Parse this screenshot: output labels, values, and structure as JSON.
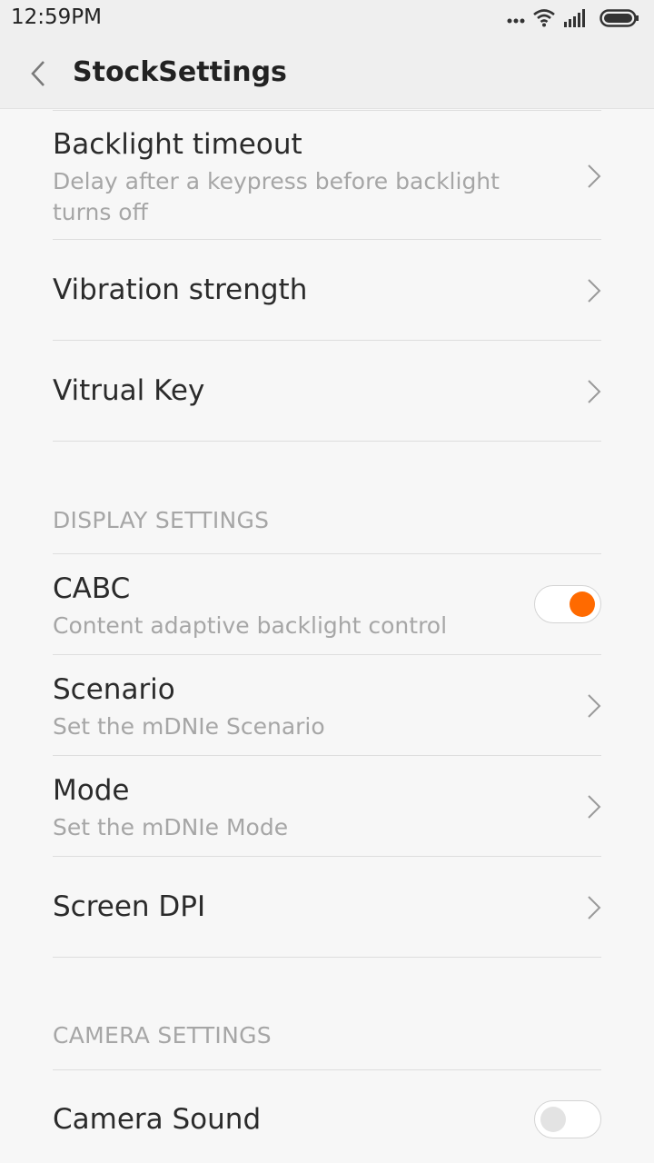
{
  "status": {
    "time": "12:59PM",
    "icons": [
      "more-dots-icon",
      "wifi-icon",
      "signal-icon",
      "battery-icon"
    ]
  },
  "appbar": {
    "title": "StockSettings"
  },
  "items": {
    "backlight": {
      "title": "Backlight timeout",
      "subtitle": "Delay after a keypress before backlight turns off"
    },
    "vibration": {
      "title": "Vibration strength"
    },
    "virtual_key": {
      "title": "Vitrual Key"
    },
    "cabc": {
      "title": "CABC",
      "subtitle": "Content adaptive backlight control",
      "enabled": true
    },
    "scenario": {
      "title": "Scenario",
      "subtitle": "Set the mDNIe Scenario"
    },
    "mode": {
      "title": "Mode",
      "subtitle": "Set the mDNIe Mode"
    },
    "screen_dpi": {
      "title": "Screen DPI"
    },
    "camera_sound": {
      "title": "Camera Sound",
      "enabled": false
    }
  },
  "sections": {
    "display": "DISPLAY SETTINGS",
    "camera": "CAMERA SETTINGS"
  },
  "colors": {
    "accent": "#ff6a00",
    "background": "#f7f7f7",
    "secondary_text": "#a6a6a6"
  }
}
